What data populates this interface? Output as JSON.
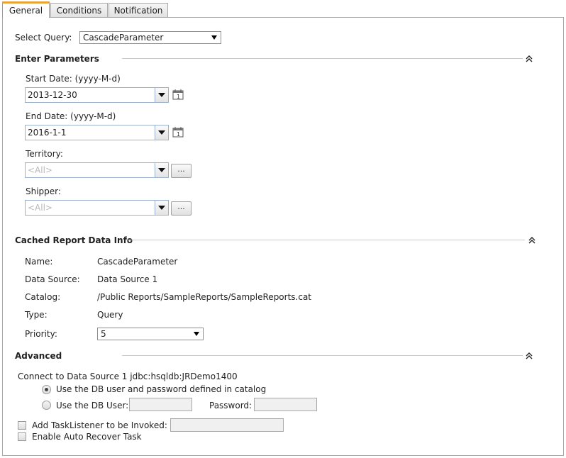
{
  "tabs": [
    {
      "label": "General"
    },
    {
      "label": "Conditions"
    },
    {
      "label": "Notification"
    }
  ],
  "select_query": {
    "label": "Select Query:",
    "value": "CascadeParameter"
  },
  "enter_parameters": {
    "title": "Enter Parameters",
    "start_date": {
      "label": "Start Date: (yyyy-M-d)",
      "value": "2013-12-30"
    },
    "end_date": {
      "label": "End Date: (yyyy-M-d)",
      "value": "2016-1-1"
    },
    "territory": {
      "label": "Territory:",
      "value": "<All>",
      "more": "..."
    },
    "shipper": {
      "label": "Shipper:",
      "value": "<All>",
      "more": "..."
    }
  },
  "cached_info": {
    "title": "Cached Report Data Info",
    "name_label": "Name:",
    "name_value": "CascadeParameter",
    "datasource_label": "Data Source:",
    "datasource_value": "Data Source 1",
    "catalog_label": "Catalog:",
    "catalog_value": "/Public Reports/SampleReports/SampleReports.cat",
    "type_label": "Type:",
    "type_value": "Query",
    "priority_label": "Priority:",
    "priority_value": "5"
  },
  "advanced": {
    "title": "Advanced",
    "connect_text": "Connect to Data Source 1 jdbc:hsqldb:JRDemo1400",
    "radio_catalog": "Use the DB user and password defined in catalog",
    "radio_db_user": "Use the DB User:",
    "password_label": "Password:",
    "task_listener": "Add TaskListener to be Invoked:",
    "auto_recover": "Enable Auto Recover Task"
  },
  "icons": {
    "calendar": "calendar-icon",
    "collapse": "double-chevron-up-icon"
  }
}
